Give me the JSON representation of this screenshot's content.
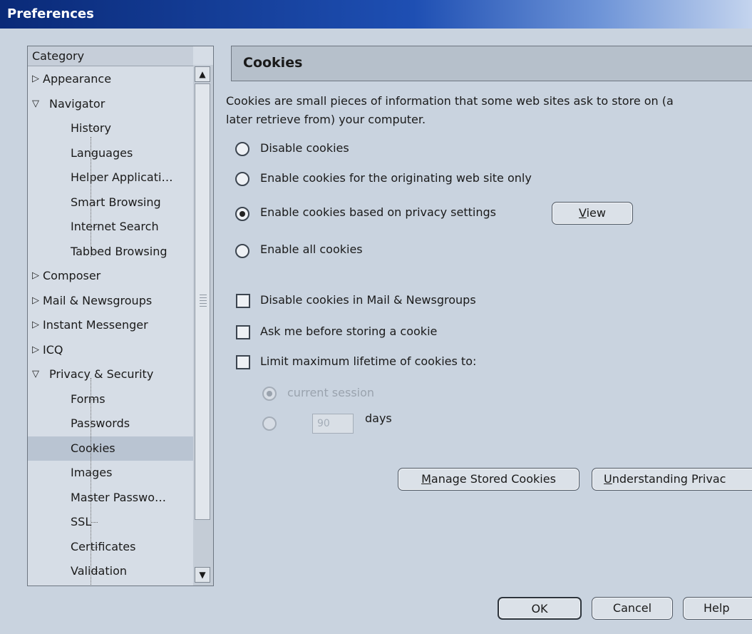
{
  "window": {
    "title": "Preferences"
  },
  "category": {
    "header": "Category",
    "items": [
      {
        "label": "Appearance",
        "level": 0,
        "twisty": "closed"
      },
      {
        "label": "Navigator",
        "level": 0,
        "twisty": "open"
      },
      {
        "label": "History",
        "level": 1
      },
      {
        "label": "Languages",
        "level": 1
      },
      {
        "label": "Helper Applicati…",
        "level": 1
      },
      {
        "label": "Smart Browsing",
        "level": 1
      },
      {
        "label": "Internet Search",
        "level": 1
      },
      {
        "label": "Tabbed Browsing",
        "level": 1
      },
      {
        "label": "Composer",
        "level": 0,
        "twisty": "closed"
      },
      {
        "label": "Mail & Newsgroups",
        "level": 0,
        "twisty": "closed"
      },
      {
        "label": "Instant Messenger",
        "level": 0,
        "twisty": "closed"
      },
      {
        "label": "ICQ",
        "level": 0,
        "twisty": "closed"
      },
      {
        "label": "Privacy & Security",
        "level": 0,
        "twisty": "open"
      },
      {
        "label": "Forms",
        "level": 1
      },
      {
        "label": "Passwords",
        "level": 1
      },
      {
        "label": "Cookies",
        "level": 1,
        "selected": true
      },
      {
        "label": "Images",
        "level": 1
      },
      {
        "label": "Master Passwo…",
        "level": 1
      },
      {
        "label": "SSL",
        "level": 1
      },
      {
        "label": "Certificates",
        "level": 1
      },
      {
        "label": "Validation",
        "level": 1
      }
    ],
    "scroll_up_icon": "arrow-up-icon",
    "scroll_down_icon": "arrow-down-icon"
  },
  "cookies": {
    "title": "Cookies",
    "description_line1": "Cookies are small pieces of information that some web sites ask to store on (a",
    "description_line2": "later retrieve from) your computer.",
    "options": {
      "disable": "Disable cookies",
      "originating": "Enable cookies for the originating web site only",
      "privacy": "Enable cookies based on privacy settings",
      "all": "Enable all cookies"
    },
    "selected_option": "privacy",
    "view_button": {
      "before": "",
      "mnemonic": "V",
      "after": "iew"
    },
    "checkboxes": {
      "mail": {
        "label": "Disable cookies in Mail & Newsgroups",
        "checked": false
      },
      "ask": {
        "label": "Ask me before storing a cookie",
        "checked": false
      },
      "limit": {
        "label": "Limit maximum lifetime of cookies to:",
        "checked": false
      }
    },
    "lifetime": {
      "current_session": "current session",
      "days_value": "90",
      "days_label": "days"
    },
    "manage_button": {
      "before": "",
      "mnemonic": "M",
      "after": "anage Stored Cookies"
    },
    "understanding_button": {
      "before": "",
      "mnemonic": "U",
      "after": "nderstanding Privac"
    }
  },
  "footer": {
    "ok": "OK",
    "cancel": "Cancel",
    "help": "Help"
  }
}
